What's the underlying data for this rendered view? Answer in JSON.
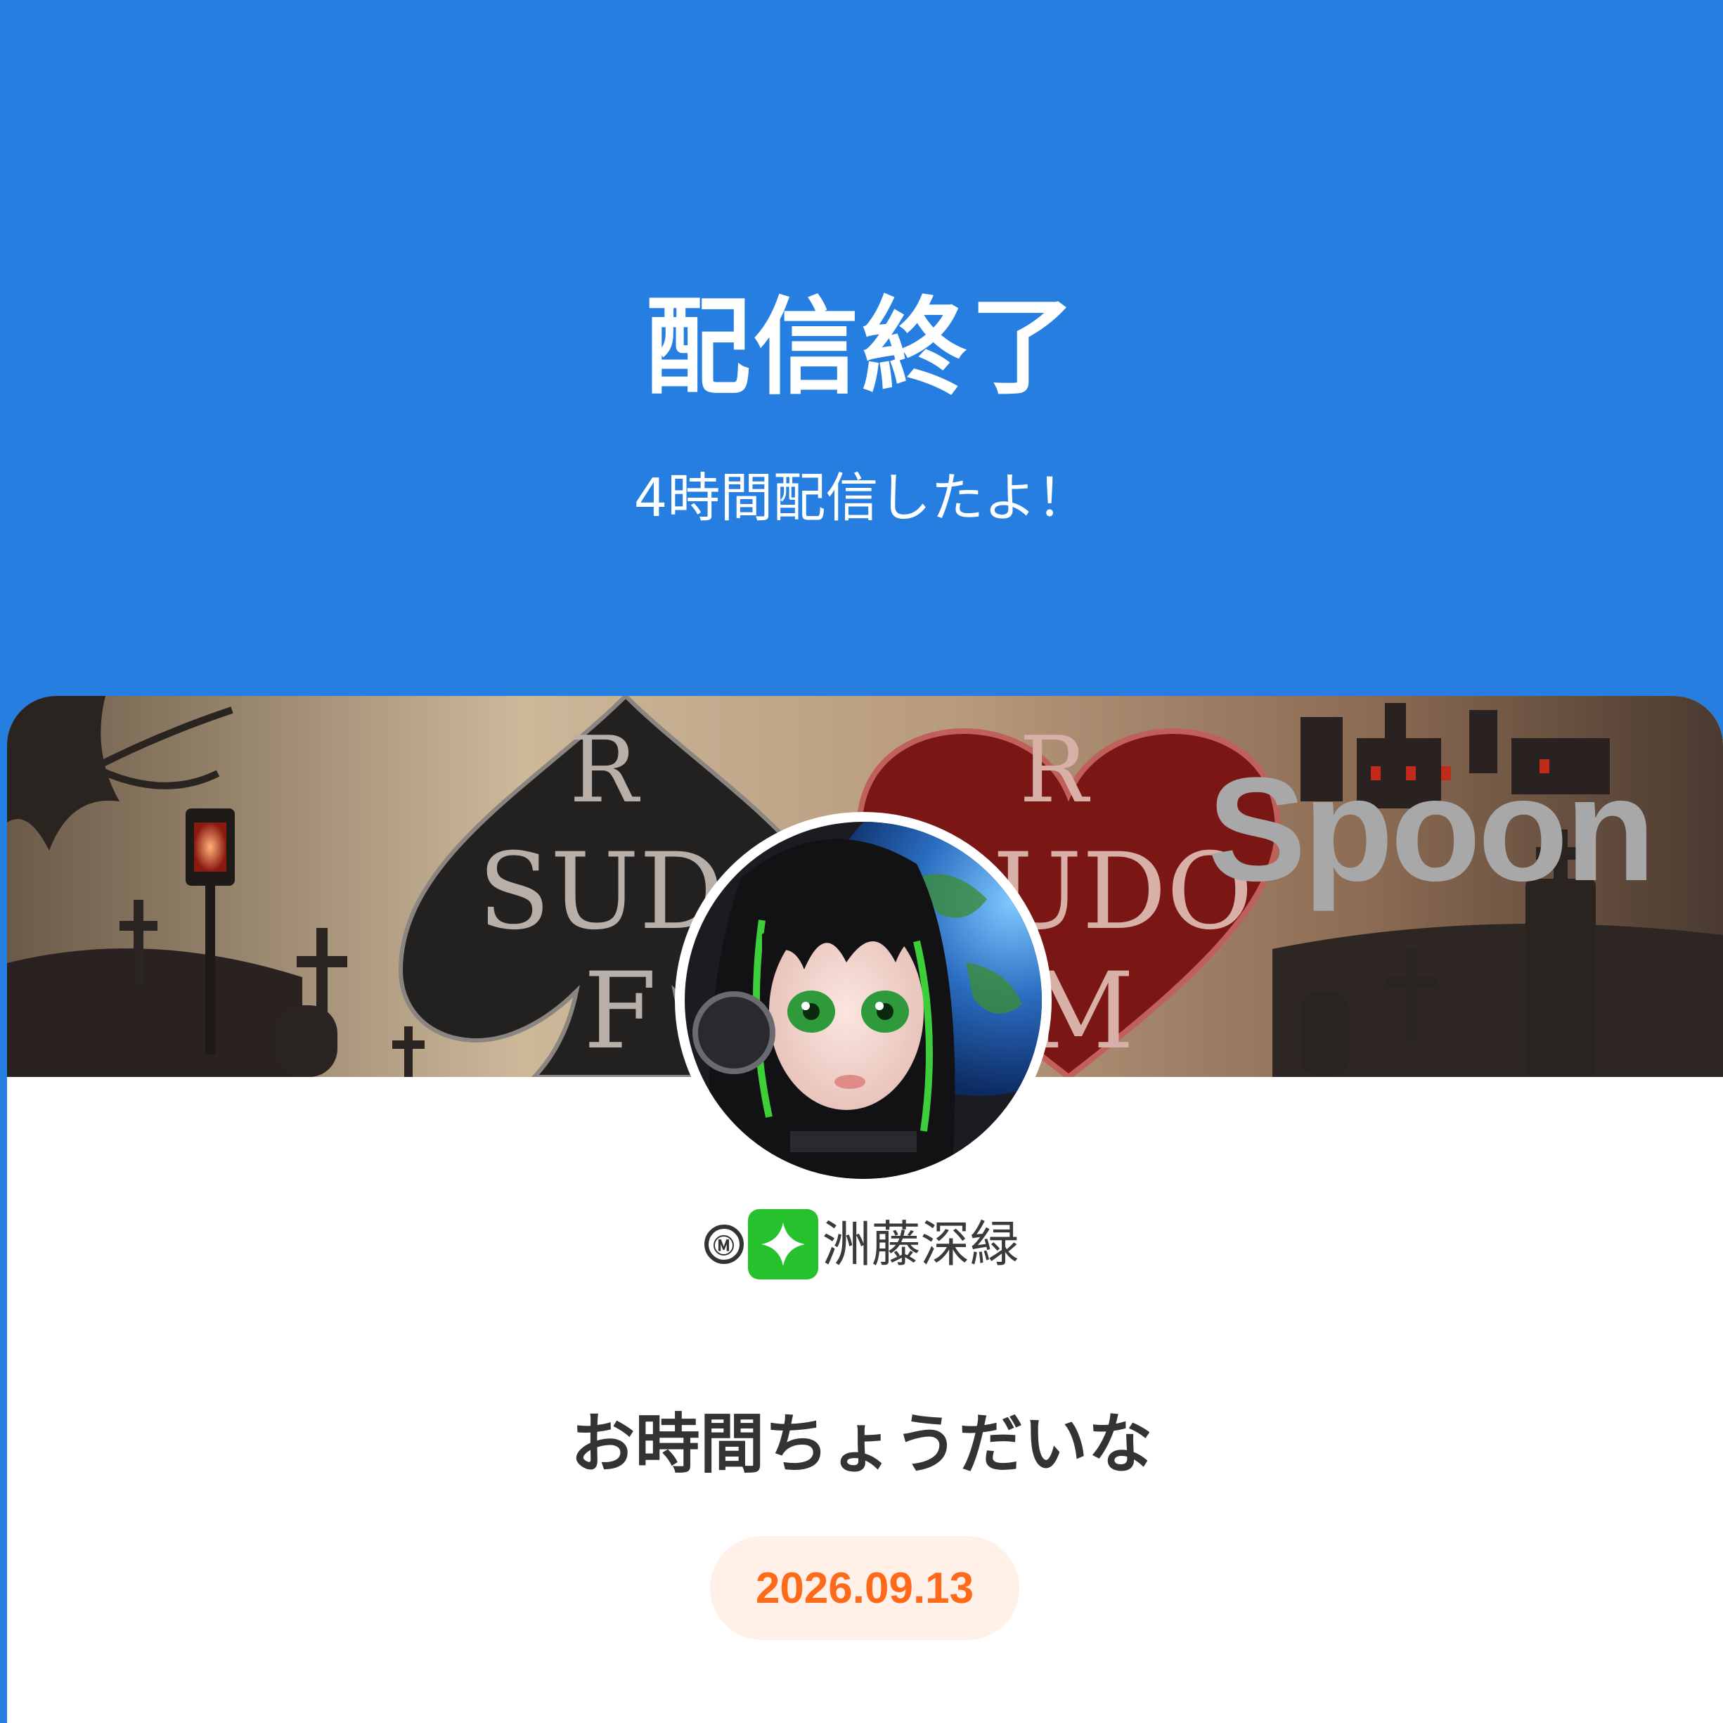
{
  "header": {
    "title": "配信終了",
    "subtitle": "4時間配信したよ！"
  },
  "banner": {
    "logo_text": "Spoon"
  },
  "profile": {
    "badge_m": "Ⓜ",
    "badge_icon": "sparkle-icon",
    "username": "洲藤深緑"
  },
  "broadcast": {
    "title": "お時間ちょうだいな",
    "date": "2026.09.13"
  },
  "colors": {
    "header_bg": "#257EE0",
    "date_text": "#FF6A1A",
    "date_bg": "#FFF0E8",
    "badge_green": "#26C22E"
  }
}
